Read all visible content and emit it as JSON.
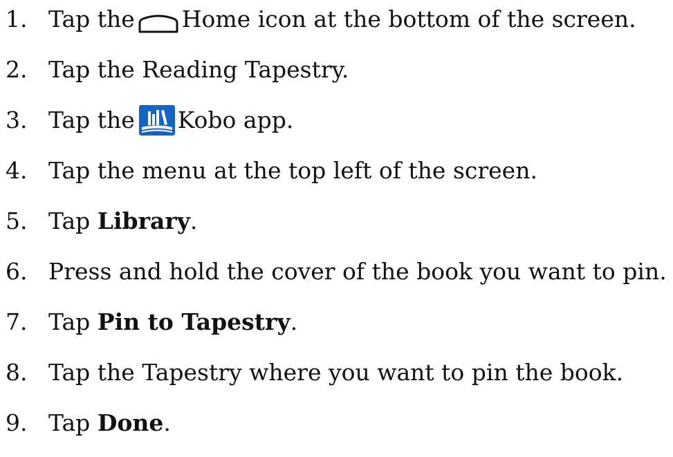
{
  "steps": [
    {
      "num": "1.",
      "pre": "Tap the",
      "post": "Home icon at the bottom of the screen.",
      "icon": "home-outline-icon"
    },
    {
      "num": "2.",
      "text": "Tap the Reading Tapestry."
    },
    {
      "num": "3.",
      "pre": "Tap the",
      "post": "Kobo app.",
      "icon": "kobo-app-icon"
    },
    {
      "num": "4.",
      "text": "Tap the menu at the top left of the screen."
    },
    {
      "num": "5.",
      "pre": "Tap ",
      "bold": "Library",
      "post": "."
    },
    {
      "num": "6.",
      "text": "Press and hold the cover of the book you want to pin."
    },
    {
      "num": "7.",
      "pre": "Tap ",
      "bold": "Pin to Tapestry",
      "post": "."
    },
    {
      "num": "8.",
      "text": "Tap the Tapestry where you want to pin the book."
    },
    {
      "num": "9.",
      "pre": "Tap ",
      "bold": "Done",
      "post": "."
    }
  ],
  "colors": {
    "text": "#111111",
    "kobo_blue": "#1565c0",
    "kobo_light": "#ffffff"
  }
}
